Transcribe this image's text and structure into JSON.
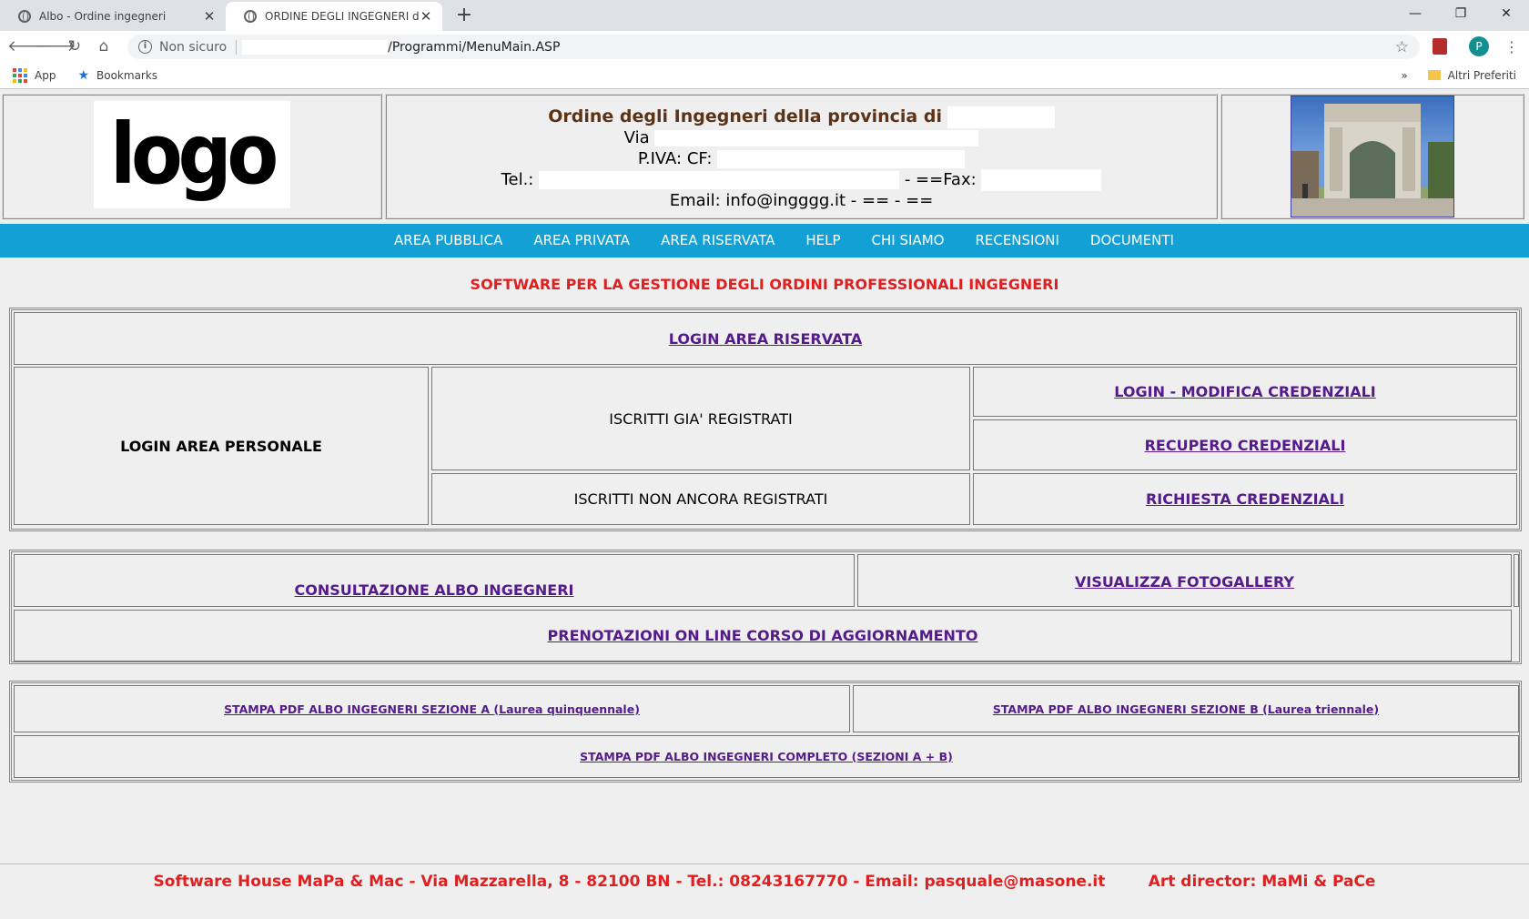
{
  "browser": {
    "tabs": [
      {
        "title": "Albo - Ordine ingegneri"
      },
      {
        "title": "ORDINE DEGLI INGEGNERI di"
      }
    ],
    "new_tab": "+",
    "window_controls": [
      "—",
      "❐",
      "✕"
    ],
    "security_label": "Non sicuro",
    "url": "/Programmi/MenuMain.ASP",
    "profile_initial": "P",
    "bookmarks": {
      "apps": "App",
      "bookmarks": "Bookmarks",
      "overflow": "»",
      "other": "Altri Preferiti"
    }
  },
  "header": {
    "logo_text": "logo",
    "org_name": "Ordine degli Ingegneri della provincia di",
    "via_label": "Via",
    "piva_label": "P.IVA: CF:",
    "tel_label": "Tel.:",
    "fax_label": "- ==Fax:",
    "email_line": "Email: info@ingggg.it - == - =="
  },
  "nav": [
    "AREA PUBBLICA",
    "AREA PRIVATA",
    "AREA RISERVATA",
    "HELP",
    "CHI SIAMO",
    "RECENSIONI",
    "DOCUMENTI"
  ],
  "subtitle": "SOFTWARE PER LA GESTIONE DEGLI ORDINI PROFESSIONALI INGEGNERI",
  "login_section": {
    "login_area_riservata": "LOGIN AREA RISERVATA",
    "login_area_personale": "LOGIN AREA PERSONALE",
    "iscritti_registrati": "ISCRITTI GIA' REGISTRATI",
    "iscritti_non_registrati": "ISCRITTI NON ANCORA REGISTRATI",
    "login_modifica": "LOGIN - MODIFICA CREDENZIALI",
    "recupero": "RECUPERO CREDENZIALI",
    "richiesta": "RICHIESTA CREDENZIALI"
  },
  "albo_section": {
    "consultazione": "CONSULTAZIONE ALBO INGEGNERI",
    "fotogallery": "VISUALIZZA FOTOGALLERY",
    "prenotazioni": "PRENOTAZIONI ON LINE CORSO DI AGGIORNAMENTO"
  },
  "pdf_section": {
    "sezione_a": "STAMPA PDF ALBO INGEGNERI SEZIONE A (Laurea quinquennale)",
    "sezione_b": "STAMPA PDF ALBO INGEGNERI SEZIONE B (Laurea triennale)",
    "completo": "STAMPA PDF ALBO INGEGNERI COMPLETO (SEZIONI A + B)"
  },
  "footer": "Software House MaPa & Mac - Via Mazzarella, 8 - 82100 BN - Tel.: 08243167770 - Email: pasquale@masone.it        Art director: MaMi & PaCe"
}
